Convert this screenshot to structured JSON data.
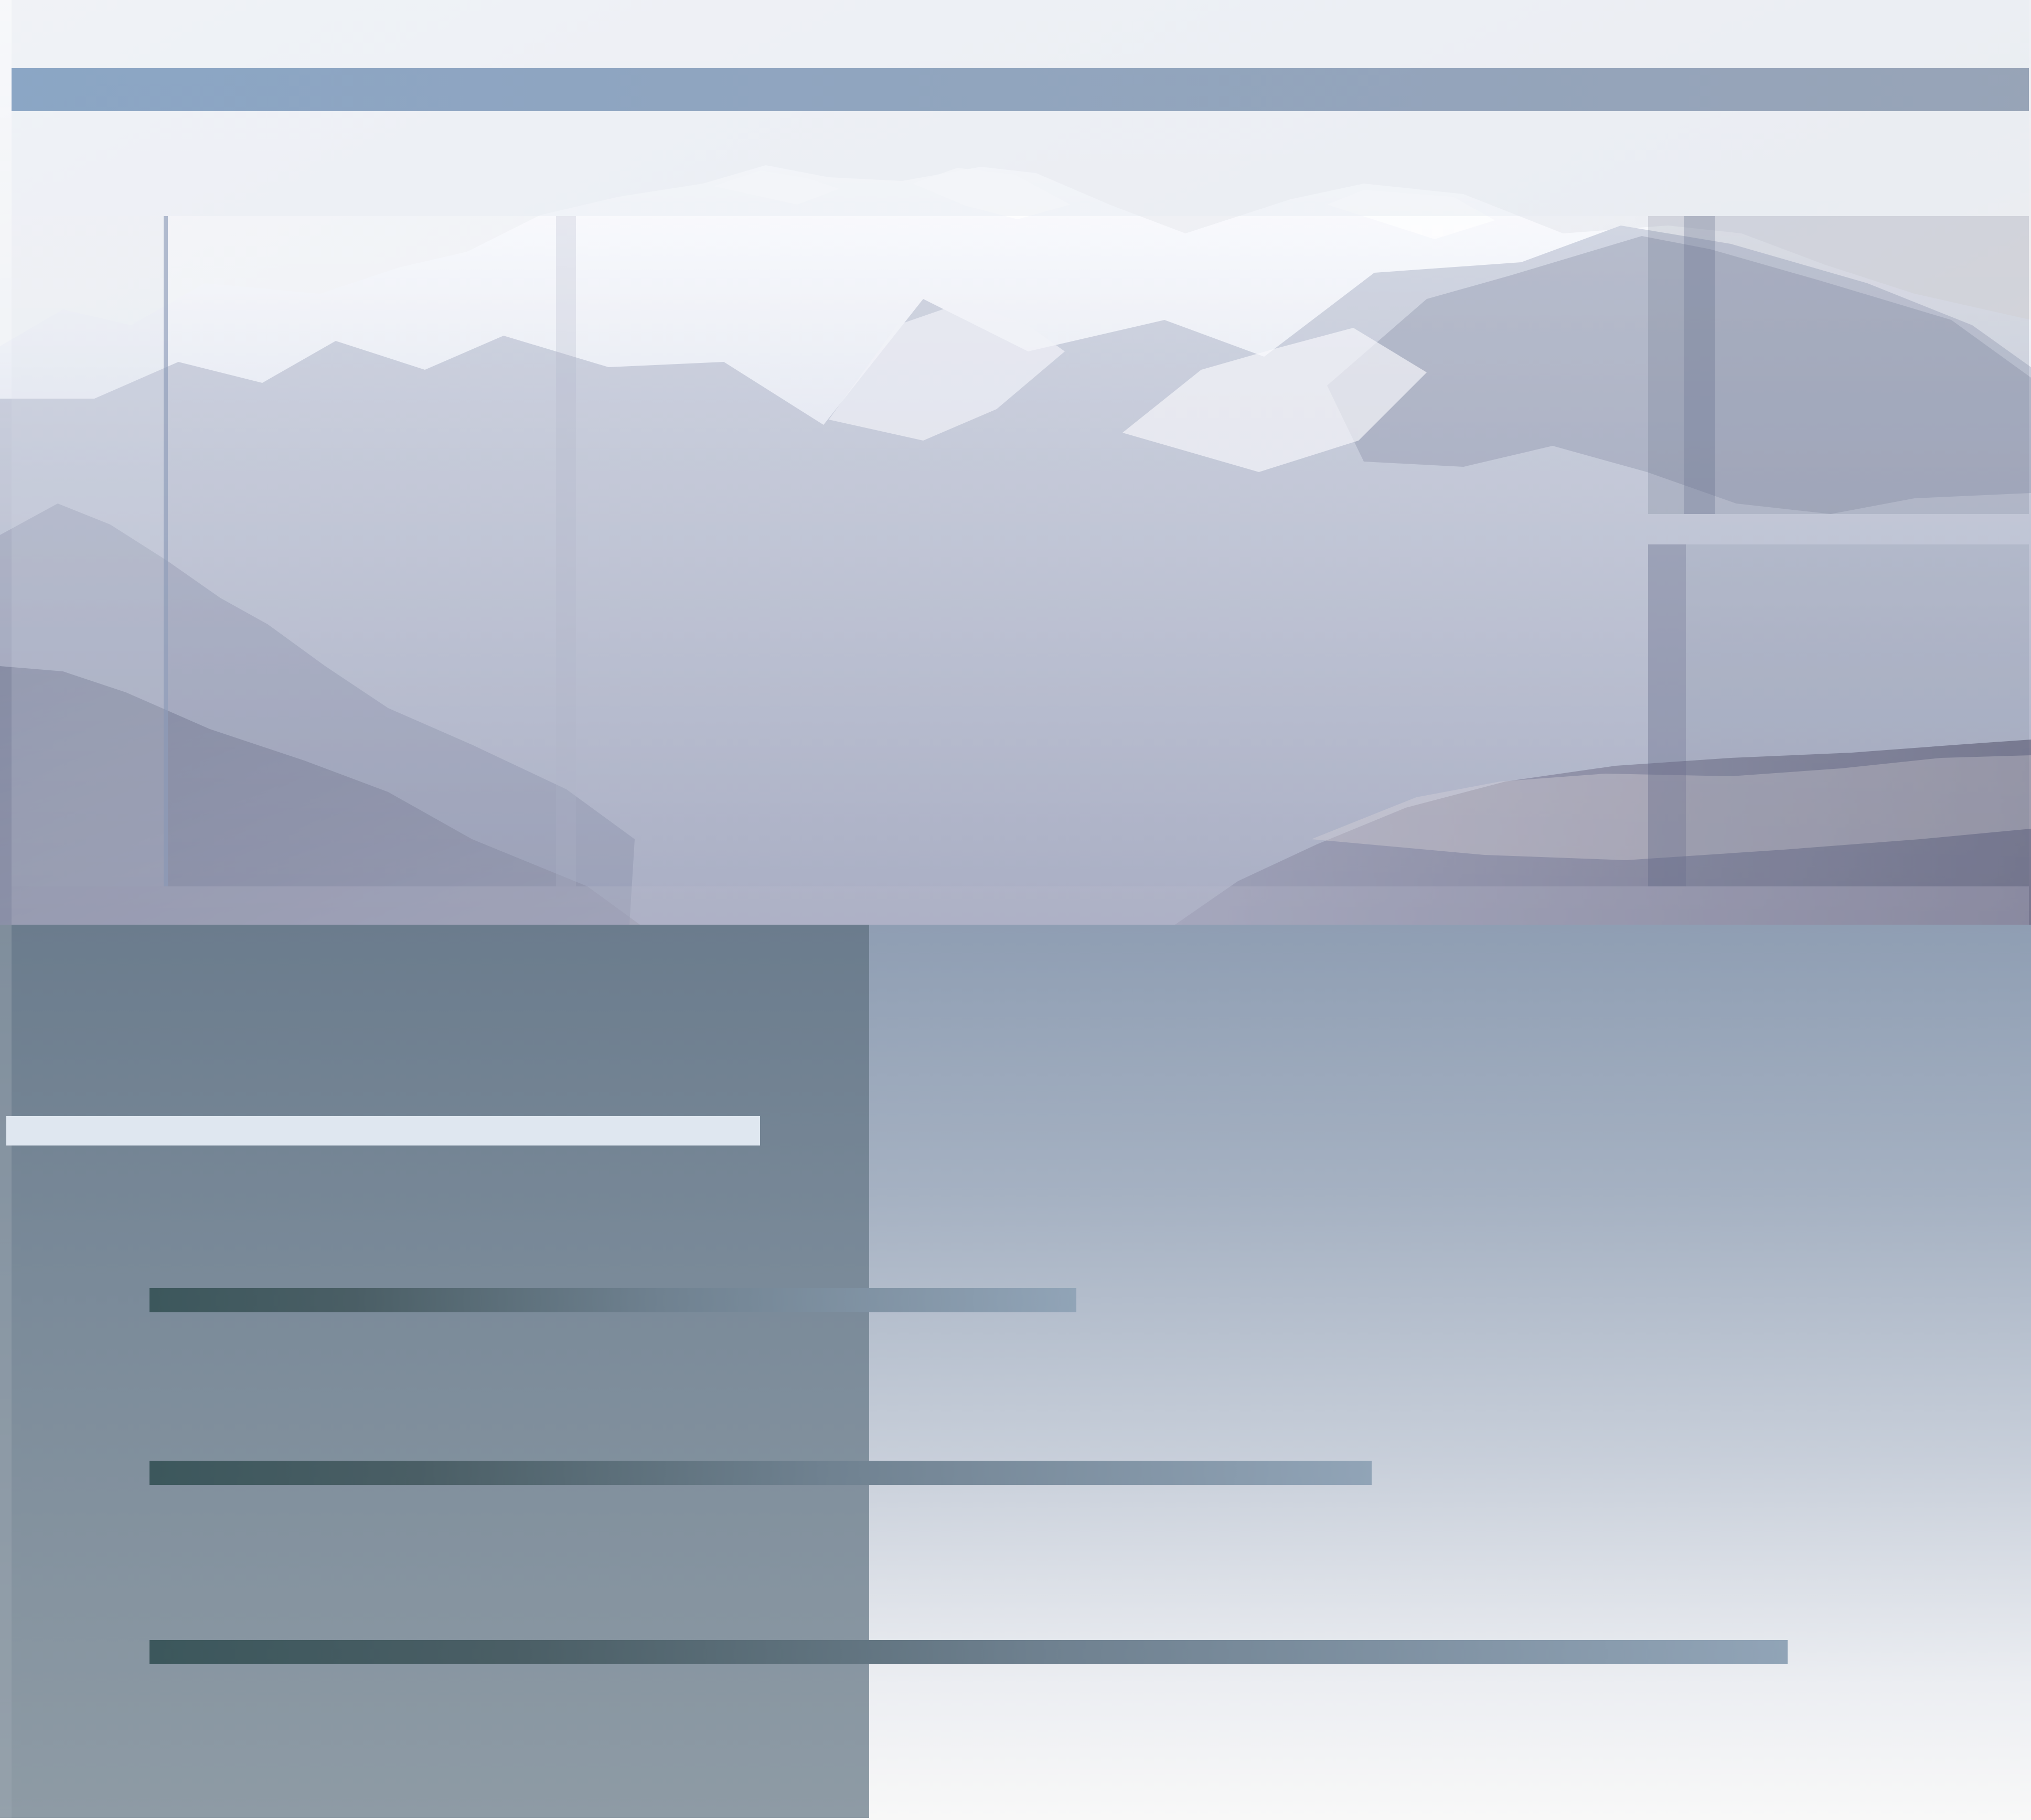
{
  "hero": {
    "image": {
      "name": "mountain-range-hero",
      "description_colors": {
        "sky_top": "#f0f2f5",
        "sky_warm": "#f4e8e0",
        "snow": "#f8f9fc",
        "mist": "#e8ebf2",
        "slope_blue": "#8d95ac",
        "slope_dark": "#6f7186"
      }
    },
    "overlay_colors": {
      "header_bar_start": "#7f9cbc",
      "header_bar_end": "#9299ab",
      "panel_tint": "#d8deea"
    }
  },
  "controls": {
    "label_bar_color": "#dfe7f0",
    "progress_levels": [
      {
        "name": "progress-bar-1",
        "level": 0.456
      },
      {
        "name": "progress-bar-2",
        "level": 0.602
      },
      {
        "name": "progress-bar-3",
        "level": 0.807
      }
    ],
    "gradient_colors": {
      "start": "#3c575c",
      "middle": "#6f8190",
      "end": "#91a4b7"
    }
  },
  "lower": {
    "background_top": "#8f9eb3",
    "background_bottom": "#f8f8f8",
    "dark_panel_color": "#6b7c8d"
  }
}
